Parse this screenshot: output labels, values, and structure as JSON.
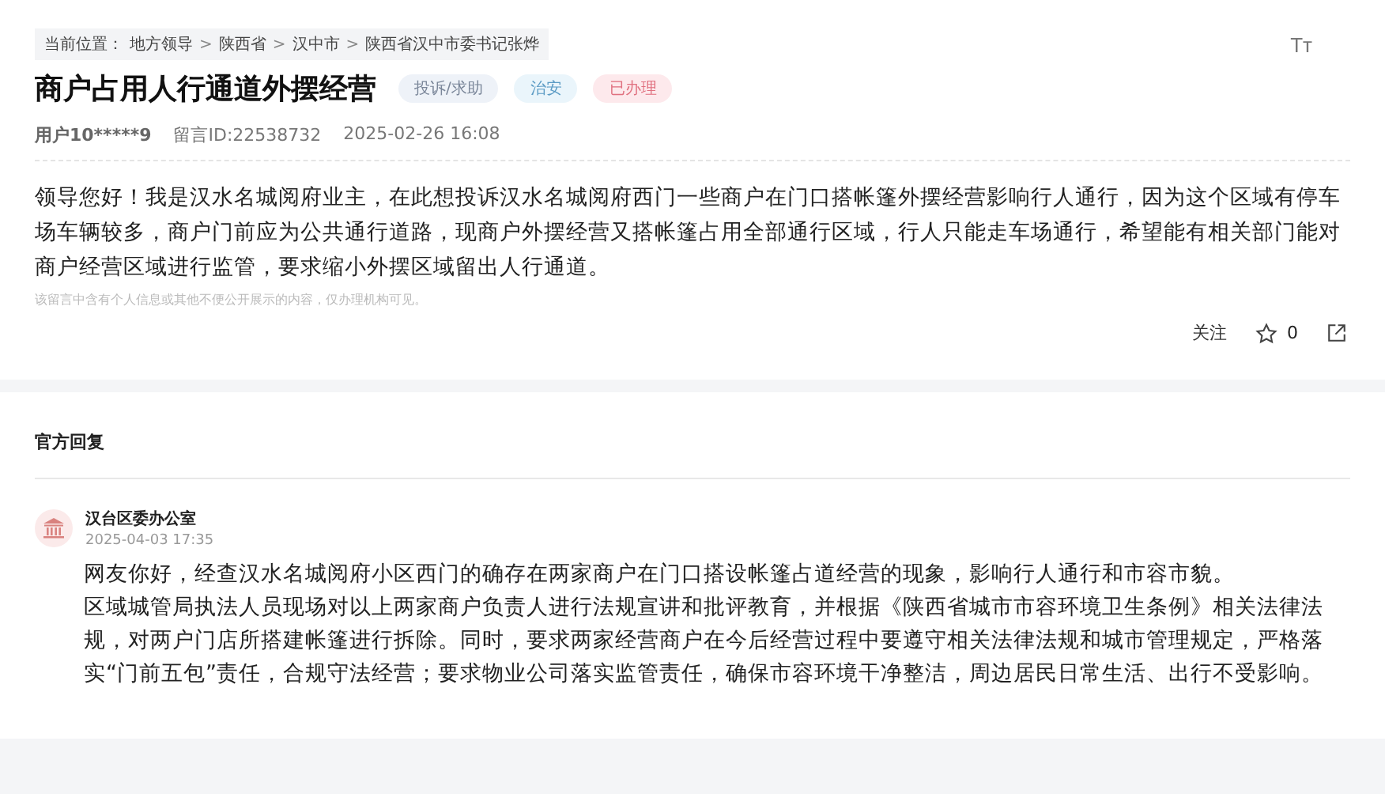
{
  "breadcrumb": {
    "label": "当前位置：",
    "items": [
      "地方领导",
      "陕西省",
      "汉中市",
      "陕西省汉中市委书记张烨"
    ],
    "separator": ">"
  },
  "font_size_button": "Tт",
  "title": "商户占用人行通道外摆经营",
  "tags": [
    {
      "label": "投诉/求助",
      "color": "#eef2f8"
    },
    {
      "label": "治安",
      "color": "#eaf5fb"
    },
    {
      "label": "已办理",
      "color": "#fde9ec"
    }
  ],
  "meta": {
    "user": "用户10*****9",
    "message_id": "留言ID:22538732",
    "time": "2025-02-26 16:08"
  },
  "body": "领导您好！我是汉水名城阅府业主，在此想投诉汉水名城阅府西门一些商户在门口搭帐篷外摆经营影响行人通行，因为这个区域有停车场车辆较多，商户门前应为公共通行道路，现商户外摆经营又搭帐篷占用全部通行区域，行人只能走车场通行，希望能有相关部门能对商户经营区域进行监管，要求缩小外摆区域留出人行通道。",
  "privacy_note": "该留言中含有个人信息或其他不便公开展示的内容，仅办理机构可见。",
  "actions": {
    "follow": "关注",
    "likes": "0"
  },
  "reply_section": {
    "heading": "官方回复",
    "office": "汉台区委办公室",
    "time": "2025-04-03 17:35",
    "paragraphs": [
      "网友你好，经查汉水名城阅府小区西门的确存在两家商户在门口搭设帐篷占道经营的现象，影响行人通行和市容市貌。",
      "区域城管局执法人员现场对以上两家商户负责人进行法规宣讲和批评教育，并根据《陕西省城市市容环境卫生条例》相关法律法规，对两户门店所搭建帐篷进行拆除。同时，要求两家经营商户在今后经营过程中要遵守相关法律法规和城市管理规定，严格落实“门前五包”责任，合规守法经营；要求物业公司落实监管责任，确保市容环境干净整洁，周边居民日常生活、出行不受影响。"
    ]
  }
}
